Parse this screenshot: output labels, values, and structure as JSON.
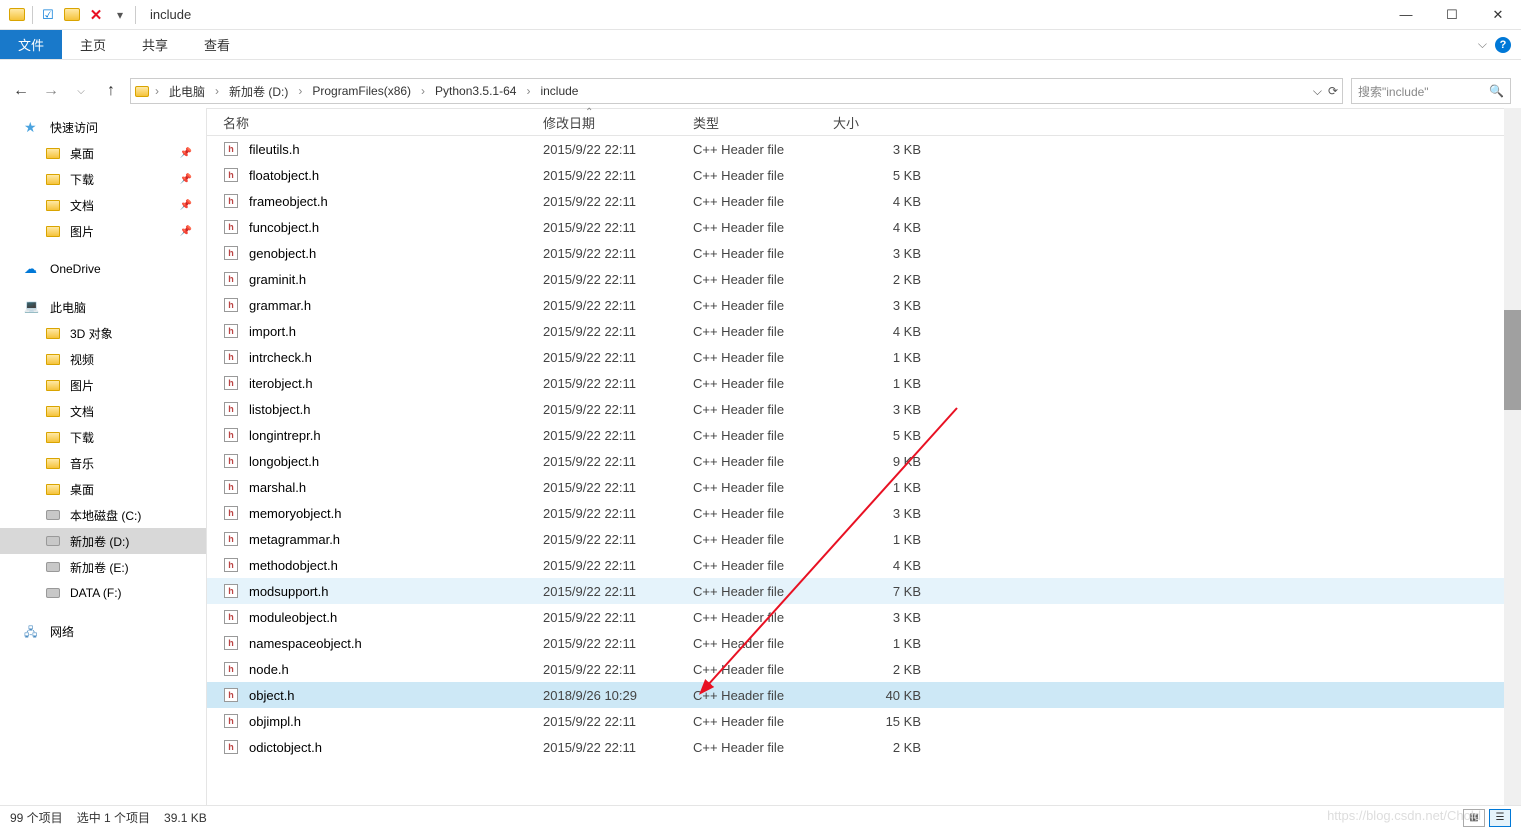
{
  "window": {
    "title": "include"
  },
  "ribbon": {
    "file": "文件",
    "tabs": [
      "主页",
      "共享",
      "查看"
    ]
  },
  "breadcrumb": {
    "items": [
      "此电脑",
      "新加卷 (D:)",
      "ProgramFiles(x86)",
      "Python3.5.1-64",
      "include"
    ]
  },
  "search": {
    "placeholder": "搜索\"include\""
  },
  "nav": {
    "quick_access": "快速访问",
    "quick_items": [
      {
        "label": "桌面",
        "pinned": true
      },
      {
        "label": "下载",
        "pinned": true
      },
      {
        "label": "文档",
        "pinned": true
      },
      {
        "label": "图片",
        "pinned": true
      }
    ],
    "onedrive": "OneDrive",
    "this_pc": "此电脑",
    "pc_items": [
      {
        "label": "3D 对象"
      },
      {
        "label": "视频"
      },
      {
        "label": "图片"
      },
      {
        "label": "文档"
      },
      {
        "label": "下载"
      },
      {
        "label": "音乐"
      },
      {
        "label": "桌面"
      },
      {
        "label": "本地磁盘 (C:)",
        "drive": true
      },
      {
        "label": "新加卷 (D:)",
        "drive": true,
        "selected": true
      },
      {
        "label": "新加卷 (E:)",
        "drive": true
      },
      {
        "label": "DATA (F:)",
        "drive": true
      }
    ],
    "network": "网络"
  },
  "columns": {
    "name": "名称",
    "date": "修改日期",
    "type": "类型",
    "size": "大小"
  },
  "files": [
    {
      "name": "fileutils.h",
      "date": "2015/9/22 22:11",
      "type": "C++ Header file",
      "size": "3 KB"
    },
    {
      "name": "floatobject.h",
      "date": "2015/9/22 22:11",
      "type": "C++ Header file",
      "size": "5 KB"
    },
    {
      "name": "frameobject.h",
      "date": "2015/9/22 22:11",
      "type": "C++ Header file",
      "size": "4 KB"
    },
    {
      "name": "funcobject.h",
      "date": "2015/9/22 22:11",
      "type": "C++ Header file",
      "size": "4 KB"
    },
    {
      "name": "genobject.h",
      "date": "2015/9/22 22:11",
      "type": "C++ Header file",
      "size": "3 KB"
    },
    {
      "name": "graminit.h",
      "date": "2015/9/22 22:11",
      "type": "C++ Header file",
      "size": "2 KB"
    },
    {
      "name": "grammar.h",
      "date": "2015/9/22 22:11",
      "type": "C++ Header file",
      "size": "3 KB"
    },
    {
      "name": "import.h",
      "date": "2015/9/22 22:11",
      "type": "C++ Header file",
      "size": "4 KB"
    },
    {
      "name": "intrcheck.h",
      "date": "2015/9/22 22:11",
      "type": "C++ Header file",
      "size": "1 KB"
    },
    {
      "name": "iterobject.h",
      "date": "2015/9/22 22:11",
      "type": "C++ Header file",
      "size": "1 KB"
    },
    {
      "name": "listobject.h",
      "date": "2015/9/22 22:11",
      "type": "C++ Header file",
      "size": "3 KB"
    },
    {
      "name": "longintrepr.h",
      "date": "2015/9/22 22:11",
      "type": "C++ Header file",
      "size": "5 KB"
    },
    {
      "name": "longobject.h",
      "date": "2015/9/22 22:11",
      "type": "C++ Header file",
      "size": "9 KB"
    },
    {
      "name": "marshal.h",
      "date": "2015/9/22 22:11",
      "type": "C++ Header file",
      "size": "1 KB"
    },
    {
      "name": "memoryobject.h",
      "date": "2015/9/22 22:11",
      "type": "C++ Header file",
      "size": "3 KB"
    },
    {
      "name": "metagrammar.h",
      "date": "2015/9/22 22:11",
      "type": "C++ Header file",
      "size": "1 KB"
    },
    {
      "name": "methodobject.h",
      "date": "2015/9/22 22:11",
      "type": "C++ Header file",
      "size": "4 KB"
    },
    {
      "name": "modsupport.h",
      "date": "2015/9/22 22:11",
      "type": "C++ Header file",
      "size": "7 KB",
      "hover": true
    },
    {
      "name": "moduleobject.h",
      "date": "2015/9/22 22:11",
      "type": "C++ Header file",
      "size": "3 KB"
    },
    {
      "name": "namespaceobject.h",
      "date": "2015/9/22 22:11",
      "type": "C++ Header file",
      "size": "1 KB"
    },
    {
      "name": "node.h",
      "date": "2015/9/22 22:11",
      "type": "C++ Header file",
      "size": "2 KB"
    },
    {
      "name": "object.h",
      "date": "2018/9/26 10:29",
      "type": "C++ Header file",
      "size": "40 KB",
      "selected": true
    },
    {
      "name": "objimpl.h",
      "date": "2015/9/22 22:11",
      "type": "C++ Header file",
      "size": "15 KB"
    },
    {
      "name": "odictobject.h",
      "date": "2015/9/22 22:11",
      "type": "C++ Header file",
      "size": "2 KB"
    }
  ],
  "status": {
    "count": "99 个项目",
    "selected": "选中 1 个项目",
    "size": "39.1 KB"
  },
  "watermark": "https://blog.csdn.net/Chold"
}
